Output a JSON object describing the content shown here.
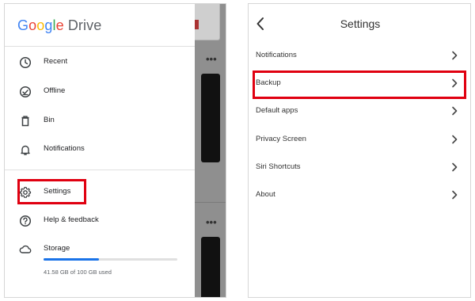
{
  "left_panel": {
    "logo": {
      "google": "Google",
      "drive": "Drive"
    },
    "nav": {
      "recent": "Recent",
      "offline": "Offline",
      "bin": "Bin",
      "notifications": "Notifications",
      "settings": "Settings",
      "help": "Help & feedback",
      "storage": "Storage"
    },
    "storage": {
      "used_text": "41.58 GB of 100 GB used",
      "used_fraction": 0.4158
    },
    "background_menu": "•••"
  },
  "right_panel": {
    "title": "Settings",
    "items": [
      "Notifications",
      "Backup",
      "Default apps",
      "Privacy Screen",
      "Siri Shortcuts",
      "About"
    ]
  },
  "colors": {
    "highlight": "#e00010",
    "storage_bar": "#1a73e8",
    "logo_blue": "#4285F4",
    "logo_red": "#EA4335",
    "logo_yellow": "#FBBC05",
    "logo_green": "#34A853"
  },
  "icons": {
    "recent": "clock-icon",
    "offline": "offline-check-icon",
    "bin": "trash-icon",
    "notifications": "bell-icon",
    "settings": "gear-icon",
    "help": "help-icon",
    "storage": "cloud-icon",
    "back": "chevron-left-icon",
    "row": "chevron-right-icon"
  }
}
